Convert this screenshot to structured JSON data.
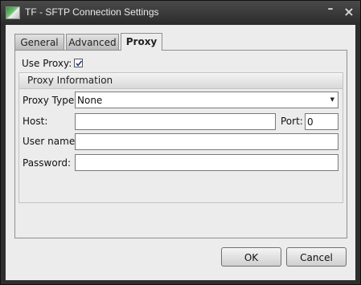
{
  "window": {
    "title": "TF - SFTP Connection Settings",
    "app_icon": "app-image-icon",
    "minimize_glyph": "–",
    "close_glyph": "×"
  },
  "tabs": [
    {
      "label": "General",
      "active": false
    },
    {
      "label": "Advanced",
      "active": false
    },
    {
      "label": "Proxy",
      "active": true
    }
  ],
  "proxy": {
    "use_proxy_label": "Use Proxy:",
    "use_proxy_checked": true,
    "group_title": "Proxy Information",
    "proxy_type_label": "Proxy Type:",
    "proxy_type_value": "None",
    "host_label": "Host:",
    "host_value": "",
    "port_label": "Port:",
    "port_value": "0",
    "username_label": "User name:",
    "username_value": "",
    "password_label": "Password:",
    "password_value": ""
  },
  "buttons": {
    "ok": "OK",
    "cancel": "Cancel"
  },
  "colors": {
    "titlebar": "#2e2e2e",
    "dialog_background": "#ececec",
    "check_mark": "#1a3a8a"
  }
}
